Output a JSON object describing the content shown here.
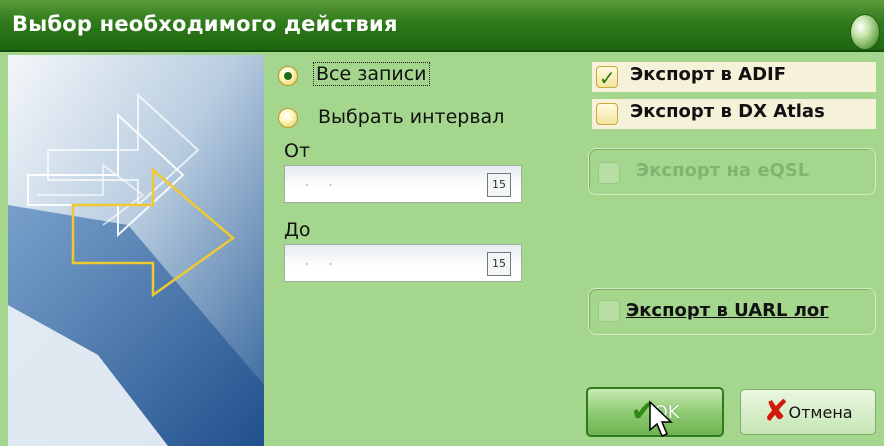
{
  "window": {
    "title": "Выбор необходимого действия"
  },
  "range": {
    "all_records_label": "Все записи",
    "select_interval_label": "Выбрать интервал",
    "selected": "all_records",
    "from_label": "От",
    "to_label": "До",
    "from_value": ". .",
    "to_value": ". .",
    "calendar_button_text": "15"
  },
  "exports": {
    "adif": {
      "label": "Экспорт в ADIF",
      "checked": true,
      "enabled": true
    },
    "dx_atlas": {
      "label": "Экспорт в DX Atlas",
      "checked": false,
      "enabled": true
    },
    "eqsl": {
      "label": "Экспорт на eQSL",
      "checked": false,
      "enabled": false
    },
    "uarl": {
      "label": "Экспорт в UARL лог",
      "checked": false,
      "enabled": true
    }
  },
  "buttons": {
    "ok_label": "OK",
    "cancel_label": "Отмена"
  },
  "colors": {
    "titlebar": "#2f7a1a",
    "background": "#a5d68e",
    "check_mark": "#2c7a14",
    "cancel_x": "#d21a0a"
  },
  "icons": {
    "title": "green-orb-icon",
    "calendar": "calendar-icon",
    "ok": "check-icon",
    "cancel": "red-x-icon",
    "cursor": "mouse-pointer-icon"
  }
}
